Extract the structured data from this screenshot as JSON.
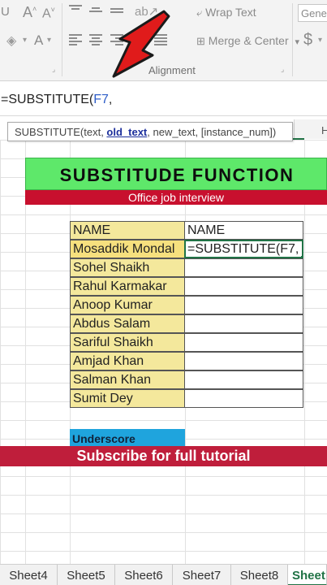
{
  "ribbon": {
    "wrap_text": "Wrap Text",
    "merge_center": "Merge & Center",
    "merge_center_caret": "▾",
    "alignment_group": "Alignment",
    "number_format": "Gene",
    "currency": "$"
  },
  "formula_bar": {
    "prefix": "=SUBSTITUTE(",
    "ref": "F7",
    "suffix": ","
  },
  "tooltip": {
    "fn": "SUBSTITUTE(",
    "arg1": "text, ",
    "current_arg": "old_text",
    "rest": ", new_text, [instance_num])"
  },
  "tab_strip_label": "H",
  "banner": {
    "title": "SUBSTITUDE FUNCTION",
    "subtitle": "Office job interview",
    "title_bg": "#5ee86a",
    "subtitle_bg": "#c8102e"
  },
  "table": {
    "header_a": "NAME",
    "header_b": "NAME",
    "rows": [
      {
        "a": "Mosaddik Mondal",
        "b": "=SUBSTITUTE(F7,"
      },
      {
        "a": "Sohel Shaikh",
        "b": ""
      },
      {
        "a": "Rahul Karmakar",
        "b": ""
      },
      {
        "a": "Anoop Kumar",
        "b": ""
      },
      {
        "a": "Abdus Salam",
        "b": ""
      },
      {
        "a": "Sariful Shaikh",
        "b": ""
      },
      {
        "a": "Amjad Khan",
        "b": ""
      },
      {
        "a": "Salman Khan",
        "b": ""
      },
      {
        "a": "Sumit Dey",
        "b": ""
      }
    ]
  },
  "underscore_label": "Underscore",
  "subscribe_text": "Subscribe for full tutorial",
  "sheet_tabs": [
    "Sheet4",
    "Sheet5",
    "Sheet6",
    "Sheet7",
    "Sheet8",
    "Sheet"
  ],
  "active_sheet": "Sheet",
  "colors": {
    "excel_green": "#217346",
    "name_column": "#f4e89c",
    "underscore_bg": "#1fa4dd",
    "subscribe_bg": "#bf1e3b",
    "arrow": "#e01b1b"
  }
}
